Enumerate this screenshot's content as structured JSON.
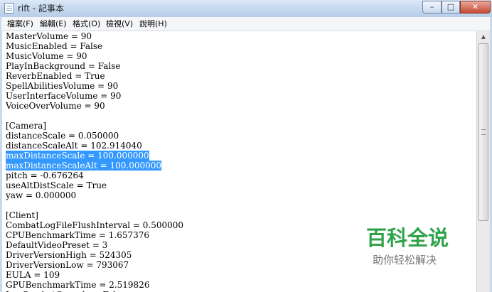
{
  "window": {
    "title": "rift - 記事本",
    "controls": {
      "minimize": "–",
      "maximize": "□",
      "close": "✕"
    }
  },
  "menu": [
    {
      "label": "檔案(F)"
    },
    {
      "label": "編輯(E)"
    },
    {
      "label": "格式(O)"
    },
    {
      "label": "檢視(V)"
    },
    {
      "label": "說明(H)"
    }
  ],
  "editor": {
    "lines": [
      {
        "text": "MasterVolume = 90"
      },
      {
        "text": "MusicEnabled = False"
      },
      {
        "text": "MusicVolume = 90"
      },
      {
        "text": "PlayInBackground = False"
      },
      {
        "text": "ReverbEnabled = True"
      },
      {
        "text": "SpellAbilitiesVolume = 90"
      },
      {
        "text": "UserInterfaceVolume = 90"
      },
      {
        "text": "VoiceOverVolume = 90"
      },
      {
        "text": ""
      },
      {
        "text": "[Camera]"
      },
      {
        "text": "distanceScale = 0.050000"
      },
      {
        "text": "distanceScaleAlt = 102.914040"
      },
      {
        "text": "maxDistanceScale = 100.000000",
        "selected": true
      },
      {
        "text": "maxDistanceScaleAlt = 100.000000",
        "selected": true
      },
      {
        "text": "pitch = -0.676264"
      },
      {
        "text": "useAltDistScale = True"
      },
      {
        "text": "yaw = 0.000000"
      },
      {
        "text": ""
      },
      {
        "text": "[Client]"
      },
      {
        "text": "CombatLogFileFlushInterval = 0.500000"
      },
      {
        "text": "CPUBenchmarkTime = 1.657376"
      },
      {
        "text": "DefaultVideoPreset = 3"
      },
      {
        "text": "DriverVersionHigh = 524305"
      },
      {
        "text": "DriverVersionLow = 793067"
      },
      {
        "text": "EULA = 109"
      },
      {
        "text": "GPUBenchmarkTime = 2.519826"
      },
      {
        "text": "LogCombatConsole = False"
      }
    ]
  },
  "scrollbar": {
    "up_arrow": "▲"
  },
  "watermark": {
    "title": "百科全说",
    "subtitle": "助你轻松解决"
  },
  "colors": {
    "selection": "#3399ff",
    "watermark_green": "#2fa34a"
  }
}
